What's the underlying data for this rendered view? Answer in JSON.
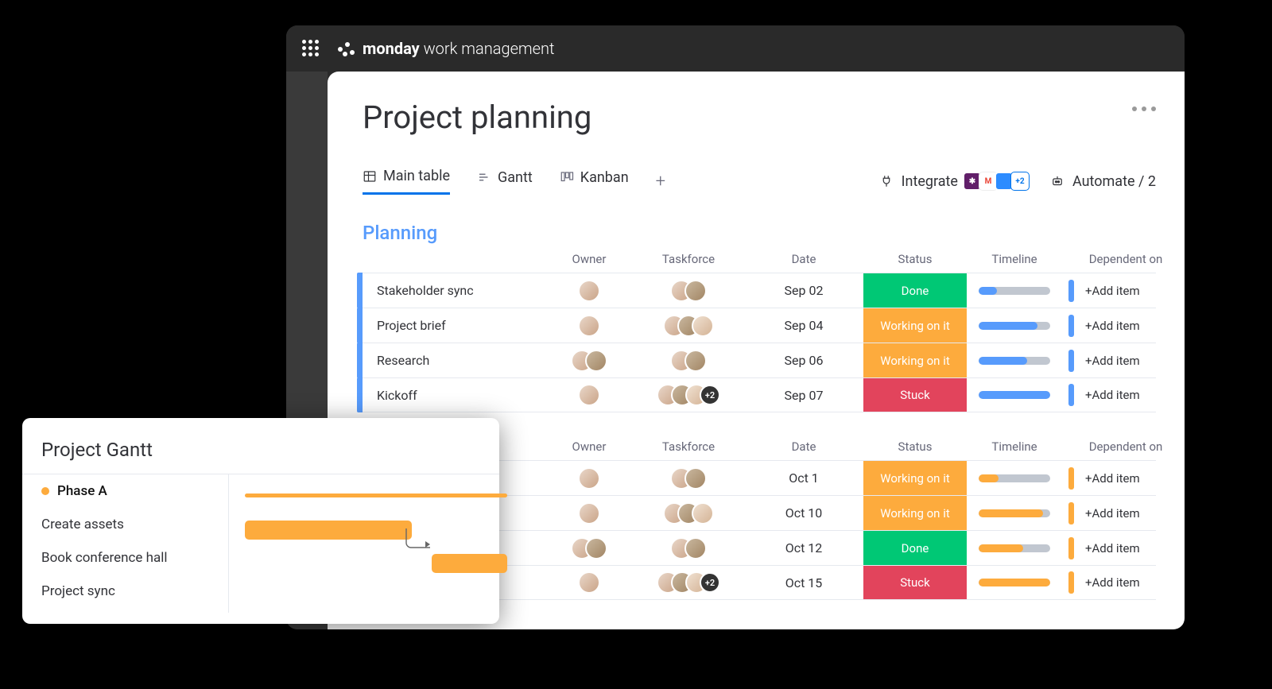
{
  "brand": {
    "bold": "monday",
    "rest": " work management"
  },
  "board": {
    "title": "Project planning",
    "tabs": [
      {
        "label": "Main table",
        "active": true
      },
      {
        "label": "Gantt",
        "active": false
      },
      {
        "label": "Kanban",
        "active": false
      }
    ],
    "integrate_label": "Integrate",
    "integrate_badges": [
      "#611f69",
      "#ea4335",
      "#2d8cff"
    ],
    "integrate_more": "+2",
    "automate_label": "Automate / 2",
    "columns": [
      "Owner",
      "Taskforce",
      "Date",
      "Status",
      "Timeline",
      "Dependent on"
    ],
    "add_item_label": "+Add item",
    "groups": [
      {
        "name": "Planning",
        "color": "blue",
        "rows": [
          {
            "name": "Stakeholder sync",
            "owner": 1,
            "taskforce": 2,
            "taskforce_plus": null,
            "date": "Sep 02",
            "status": "Done",
            "status_class": "done",
            "timeline_pct": 25
          },
          {
            "name": "Project brief",
            "owner": 1,
            "taskforce": 3,
            "taskforce_plus": null,
            "date": "Sep 04",
            "status": "Working on it",
            "status_class": "working",
            "timeline_pct": 82
          },
          {
            "name": "Research",
            "owner": 2,
            "taskforce": 2,
            "taskforce_plus": null,
            "date": "Sep 06",
            "status": "Working on it",
            "status_class": "working",
            "timeline_pct": 68
          },
          {
            "name": "Kickoff",
            "owner": 1,
            "taskforce": 3,
            "taskforce_plus": "+2",
            "date": "Sep 07",
            "status": "Stuck",
            "status_class": "stuck",
            "timeline_pct": 100
          }
        ]
      },
      {
        "name": "",
        "color": "orange",
        "rows": [
          {
            "name": "",
            "owner": 1,
            "taskforce": 2,
            "taskforce_plus": null,
            "date": "Oct 1",
            "status": "Working on it",
            "status_class": "working",
            "timeline_pct": 28
          },
          {
            "name": "",
            "owner": 1,
            "taskforce": 3,
            "taskforce_plus": null,
            "date": "Oct 10",
            "status": "Working on it",
            "status_class": "working",
            "timeline_pct": 90
          },
          {
            "name": "",
            "owner": 2,
            "taskforce": 2,
            "taskforce_plus": null,
            "date": "Oct 12",
            "status": "Done",
            "status_class": "done",
            "timeline_pct": 62
          },
          {
            "name": "",
            "owner": 1,
            "taskforce": 3,
            "taskforce_plus": "+2",
            "date": "Oct 15",
            "status": "Stuck",
            "status_class": "stuck",
            "timeline_pct": 100
          }
        ]
      }
    ]
  },
  "gantt": {
    "title": "Project Gantt",
    "phase_label": "Phase A",
    "tasks": [
      "Create assets",
      "Book conference hall",
      "Project sync"
    ]
  }
}
